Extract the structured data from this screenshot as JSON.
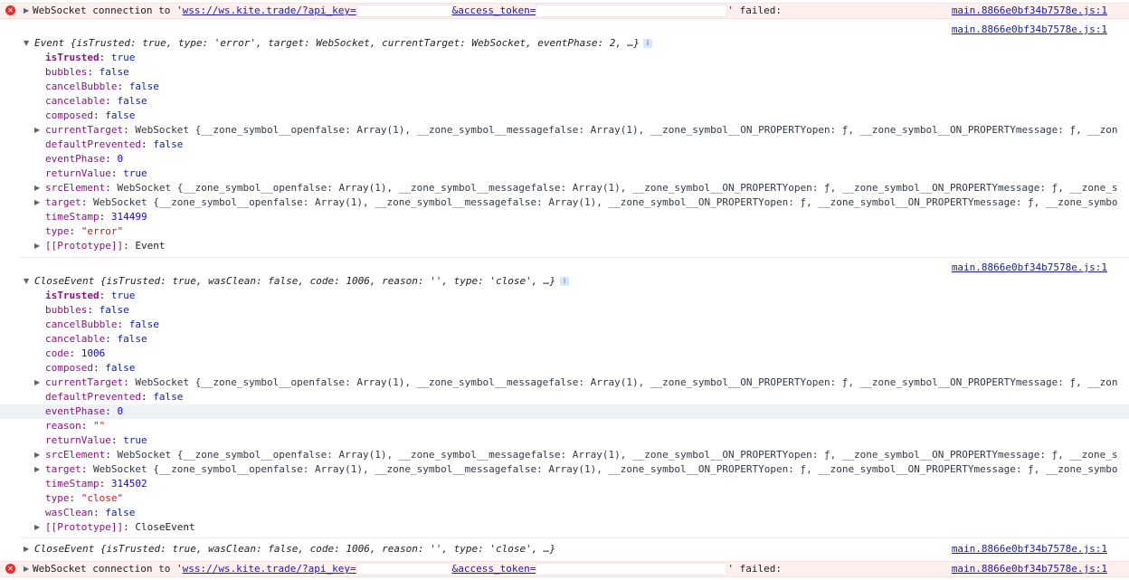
{
  "error1": {
    "prefix": "WebSocket connection to '",
    "url_part1": "wss://ws.kite.trade/?api_key=",
    "url_part2": "&access_token=",
    "suffix": "' failed:",
    "source": "main.8866e0bf34b7578e.js:1"
  },
  "event": {
    "source": "main.8866e0bf34b7578e.js:1",
    "summary_name": "Event",
    "summary_body": "{isTrusted: true, type: 'error', target: WebSocket, currentTarget: WebSocket, eventPhase: 2, …}",
    "props": [
      {
        "k": "isTrusted",
        "v": "true",
        "t": "bool",
        "bold": true
      },
      {
        "k": "bubbles",
        "v": "false",
        "t": "bool"
      },
      {
        "k": "cancelBubble",
        "v": "false",
        "t": "bool"
      },
      {
        "k": "cancelable",
        "v": "false",
        "t": "bool"
      },
      {
        "k": "composed",
        "v": "false",
        "t": "bool"
      },
      {
        "k": "currentTarget",
        "v": "WebSocket {__zone_symbol__openfalse: Array(1), __zone_symbol__messagefalse: Array(1), __zone_symbol__ON_PROPERTYopen: ƒ, __zone_symbol__ON_PROPERTYmessage: ƒ, __zon",
        "t": "obj",
        "expand": true
      },
      {
        "k": "defaultPrevented",
        "v": "false",
        "t": "bool"
      },
      {
        "k": "eventPhase",
        "v": "0",
        "t": "num"
      },
      {
        "k": "returnValue",
        "v": "true",
        "t": "bool"
      },
      {
        "k": "srcElement",
        "v": "WebSocket {__zone_symbol__openfalse: Array(1), __zone_symbol__messagefalse: Array(1), __zone_symbol__ON_PROPERTYopen: ƒ, __zone_symbol__ON_PROPERTYmessage: ƒ, __zone_s",
        "t": "obj",
        "expand": true
      },
      {
        "k": "target",
        "v": "WebSocket {__zone_symbol__openfalse: Array(1), __zone_symbol__messagefalse: Array(1), __zone_symbol__ON_PROPERTYopen: ƒ, __zone_symbol__ON_PROPERTYmessage: ƒ, __zone_symbo",
        "t": "obj",
        "expand": true
      },
      {
        "k": "timeStamp",
        "v": "314499",
        "t": "num"
      },
      {
        "k": "type",
        "v": "\"error\"",
        "t": "str"
      },
      {
        "k": "[[Prototype]]",
        "v": "Event",
        "t": "plain",
        "expand": true
      }
    ]
  },
  "close_event": {
    "source": "main.8866e0bf34b7578e.js:1",
    "summary_name": "CloseEvent",
    "summary_body": "{isTrusted: true, wasClean: false, code: 1006, reason: '', type: 'close', …}",
    "props": [
      {
        "k": "isTrusted",
        "v": "true",
        "t": "bool",
        "bold": true
      },
      {
        "k": "bubbles",
        "v": "false",
        "t": "bool"
      },
      {
        "k": "cancelBubble",
        "v": "false",
        "t": "bool"
      },
      {
        "k": "cancelable",
        "v": "false",
        "t": "bool"
      },
      {
        "k": "code",
        "v": "1006",
        "t": "num"
      },
      {
        "k": "composed",
        "v": "false",
        "t": "bool"
      },
      {
        "k": "currentTarget",
        "v": "WebSocket {__zone_symbol__openfalse: Array(1), __zone_symbol__messagefalse: Array(1), __zone_symbol__ON_PROPERTYopen: ƒ, __zone_symbol__ON_PROPERTYmessage: ƒ, __zon",
        "t": "obj",
        "expand": true
      },
      {
        "k": "defaultPrevented",
        "v": "false",
        "t": "bool"
      },
      {
        "k": "eventPhase",
        "v": "0",
        "t": "num",
        "hl": true
      },
      {
        "k": "reason",
        "v": "\"\"",
        "t": "str"
      },
      {
        "k": "returnValue",
        "v": "true",
        "t": "bool"
      },
      {
        "k": "srcElement",
        "v": "WebSocket {__zone_symbol__openfalse: Array(1), __zone_symbol__messagefalse: Array(1), __zone_symbol__ON_PROPERTYopen: ƒ, __zone_symbol__ON_PROPERTYmessage: ƒ, __zone_s",
        "t": "obj",
        "expand": true
      },
      {
        "k": "target",
        "v": "WebSocket {__zone_symbol__openfalse: Array(1), __zone_symbol__messagefalse: Array(1), __zone_symbol__ON_PROPERTYopen: ƒ, __zone_symbol__ON_PROPERTYmessage: ƒ, __zone_symbo",
        "t": "obj",
        "expand": true
      },
      {
        "k": "timeStamp",
        "v": "314502",
        "t": "num"
      },
      {
        "k": "type",
        "v": "\"close\"",
        "t": "str"
      },
      {
        "k": "wasClean",
        "v": "false",
        "t": "bool"
      },
      {
        "k": "[[Prototype]]",
        "v": "CloseEvent",
        "t": "plain",
        "expand": true
      }
    ]
  },
  "close_event2": {
    "source": "main.8866e0bf34b7578e.js:1",
    "summary_name": "CloseEvent",
    "summary_body": "{isTrusted: true, wasClean: false, code: 1006, reason: '', type: 'close', …}"
  },
  "error2": {
    "prefix": "WebSocket connection to '",
    "url_part1": "wss://ws.kite.trade/?api_key=",
    "url_part2": "&access_token=",
    "suffix": "' failed:",
    "source": "main.8866e0bf34b7578e.js:1"
  },
  "colors": {
    "error_bg": "#fff0f0",
    "key": "#881280",
    "number": "#1c00cf",
    "string": "#c41a16",
    "link": "#1a1aa6"
  }
}
